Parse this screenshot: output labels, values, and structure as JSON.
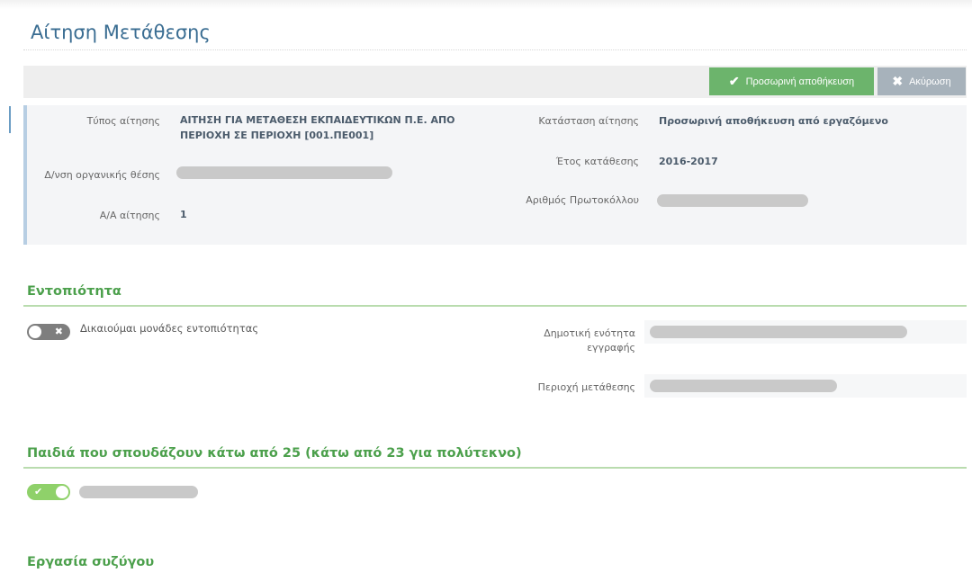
{
  "page": {
    "title": "Αίτηση Μετάθεσης"
  },
  "toolbar": {
    "save_label": "Προσωρινή αποθήκευση",
    "save_icon": "check-icon",
    "cancel_label": "Ακύρωση",
    "cancel_icon": "close-icon"
  },
  "application": {
    "type_label": "Τύπος αίτησης",
    "type_value": "ΑΙΤΗΣΗ ΓΙΑ ΜΕΤΑΘΕΣΗ ΕΚΠΑΙΔΕΥΤΙΚΩΝ Π.Ε. ΑΠΟ ΠΕΡΙΟΧΗ ΣΕ ΠΕΡΙΟΧΗ [001.ΠΕ001]",
    "org_position_label": "Δ/νση οργανικής θέσης",
    "aa_label": "Α/Α αίτησης",
    "aa_value": "1",
    "status_label": "Κατάσταση αίτησης",
    "status_value": "Προσωρινή αποθήκευση από εργαζόμενο",
    "year_label": "Έτος κατάθεσης",
    "year_value": "2016-2017",
    "protocol_label": "Αριθμός Πρωτοκόλλου"
  },
  "locality": {
    "title": "Εντοπιότητα",
    "toggle_label": "Δικαιούμαι μονάδες εντοπιότητας",
    "toggle_on": false,
    "municipal_unit_label": "Δημοτική ενότητα εγγραφής",
    "transfer_area_label": "Περιοχή μετάθεσης"
  },
  "children": {
    "title": "Παιδιά που σπουδάζουν κάτω από 25 (κάτω από 23 για πολύτεκνο)",
    "toggle_on": true
  },
  "spouse": {
    "title": "Εργασία συζύγου"
  },
  "colors": {
    "accent_blue": "#3a6d92",
    "section_green": "#4ca04c",
    "save_green": "#6cb46c",
    "cancel_gray": "#a7b2bb"
  }
}
